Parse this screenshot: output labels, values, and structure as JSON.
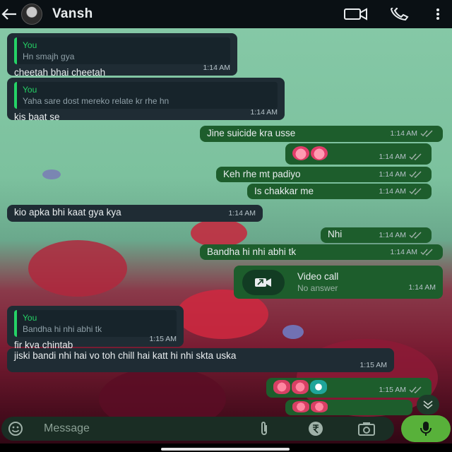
{
  "header": {
    "contact_name": "Vansh",
    "icons": [
      "back-arrow-icon",
      "video-call-icon",
      "voice-call-icon",
      "more-options-icon"
    ]
  },
  "messages": [
    {
      "dir": "in",
      "quote_author": "You",
      "quote_text": "Hn smajh gya",
      "text": "cheetah bhai cheetah",
      "time": "1:14 AM"
    },
    {
      "dir": "in",
      "quote_author": "You",
      "quote_text": "Yaha sare dost mereko relate kr rhe hn",
      "text": "kis baat se",
      "time": "1:14 AM"
    },
    {
      "dir": "out",
      "text": "Jine suicide kra usse",
      "time": "1:14 AM"
    },
    {
      "dir": "out",
      "emoji": [
        "smiling-face-with-hearts",
        "smiling-face-with-hearts"
      ],
      "time": "1:14 AM"
    },
    {
      "dir": "out",
      "text": "Keh rhe mt padiyo",
      "time": "1:14 AM"
    },
    {
      "dir": "out",
      "text": "Is chakkar me",
      "time": "1:14 AM"
    },
    {
      "dir": "in",
      "text": "kio apka bhi kaat gya kya",
      "time": "1:14 AM"
    },
    {
      "dir": "out",
      "text": "Nhi",
      "time": "1:14 AM"
    },
    {
      "dir": "out",
      "text": "Bandha hi nhi abhi tk",
      "time": "1:14 AM"
    },
    {
      "dir": "out",
      "call_title": "Video call",
      "call_status": "No answer",
      "time": "1:14 AM"
    },
    {
      "dir": "in",
      "quote_author": "You",
      "quote_text": "Bandha hi nhi abhi tk",
      "text": "fir kya chintab",
      "time": "1:15 AM"
    },
    {
      "dir": "in",
      "text": "jiski bandi nhi hai vo toh chill hai katt hi nhi skta uska",
      "time": "1:15 AM"
    },
    {
      "dir": "out",
      "emoji": [
        "laughing-face",
        "laughing-face",
        "laughing-face"
      ],
      "time": "1:15 AM"
    },
    {
      "dir": "out",
      "emoji": [
        "thumbs-up",
        "thumbs-up"
      ],
      "time": ""
    }
  ],
  "composer": {
    "placeholder": "Message",
    "icons": [
      "emoji-icon",
      "attach-icon",
      "rupee-icon",
      "camera-icon",
      "mic-icon"
    ]
  },
  "colors": {
    "header_bg": "#0a1014",
    "incoming_bubble": "#1f2c34",
    "outgoing_bubble": "#1d5d2c",
    "accent_green": "#25d366",
    "mic_button": "#58b13a"
  }
}
